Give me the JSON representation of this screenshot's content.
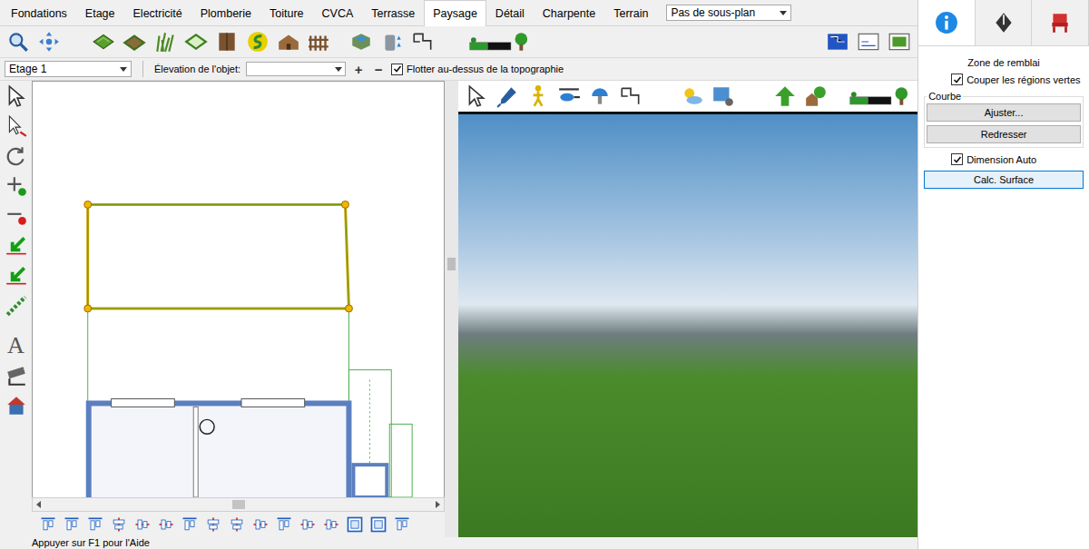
{
  "menu_tabs": [
    {
      "label": "Fondations",
      "selected": false
    },
    {
      "label": "Etage",
      "selected": false
    },
    {
      "label": "Electricité",
      "selected": false
    },
    {
      "label": "Plomberie",
      "selected": false
    },
    {
      "label": "Toiture",
      "selected": false
    },
    {
      "label": "CVCA",
      "selected": false
    },
    {
      "label": "Terrasse",
      "selected": false
    },
    {
      "label": "Paysage",
      "selected": true
    },
    {
      "label": "Détail",
      "selected": false
    },
    {
      "label": "Charpente",
      "selected": false
    },
    {
      "label": "Terrain",
      "selected": false
    }
  ],
  "plan_selector": {
    "value": "Pas de sous-plan"
  },
  "panel_tabs": [
    {
      "kind": "info",
      "selected": true
    },
    {
      "kind": "style",
      "selected": false
    },
    {
      "kind": "object",
      "selected": false
    }
  ],
  "floor_select": {
    "value": "Etage 1"
  },
  "elevation": {
    "label": "Élevation de l'objet:",
    "value": "",
    "buttons": [
      "+",
      "−"
    ]
  },
  "float_option": {
    "label": "Flotter au-dessus de la topographie",
    "checked": true
  },
  "left_toolbar": {
    "text_tool": "A"
  },
  "properties": {
    "title": "Zone de remblai",
    "cut_green": {
      "label": "Couper les régions vertes",
      "checked": true
    },
    "curve_group": {
      "title": "Courbe",
      "buttons": [
        {
          "label": "Ajuster...",
          "focused": false
        },
        {
          "label": "Redresser",
          "focused": false
        }
      ]
    },
    "auto_dimension": {
      "label": "Dimension Auto",
      "checked": true
    },
    "calc_button": {
      "label": "Calc. Surface",
      "focused": true
    }
  },
  "status_bar": {
    "text": "Appuyer sur F1 pour l'Aide"
  }
}
